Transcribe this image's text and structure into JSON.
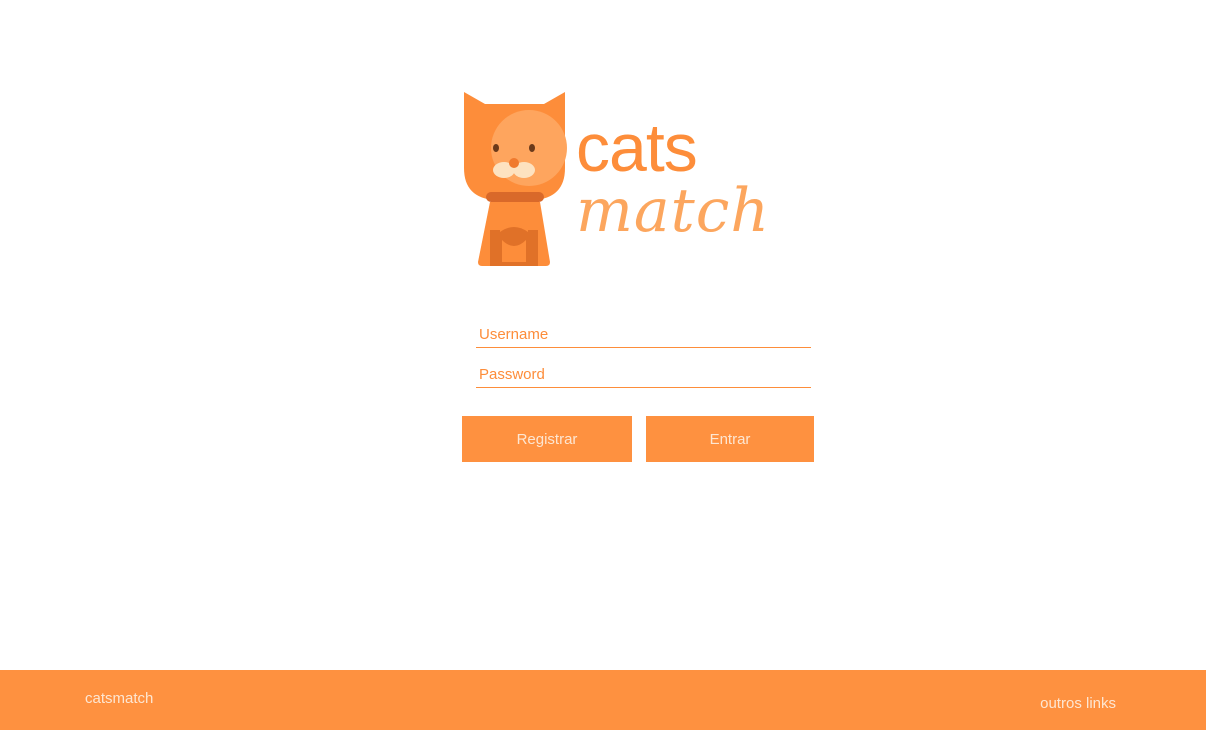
{
  "logo": {
    "word_top": "cats",
    "word_bottom": "match",
    "icon": "cat-mascot-icon"
  },
  "form": {
    "username_placeholder": "Username",
    "password_placeholder": "Password",
    "username_value": "",
    "password_value": "",
    "register_label": "Registrar",
    "login_label": "Entrar"
  },
  "footer": {
    "brand": "catsmatch",
    "links_label": "outros links"
  },
  "colors": {
    "accent": "#fe9140",
    "text_on_accent": "#fde6d2",
    "background": "#ffffff"
  }
}
